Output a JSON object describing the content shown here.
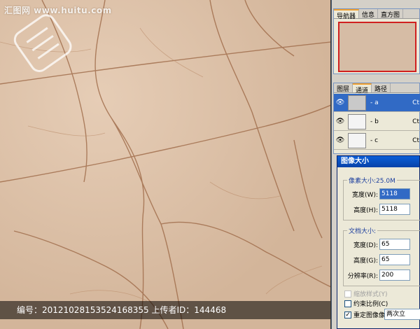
{
  "watermark": {
    "site": "汇图网 www.huitu.com",
    "center_text": "汇图网"
  },
  "caption": "编号：20121028153524168355 上传者ID：144468",
  "navigator": {
    "tabs": [
      "导航器",
      "信息",
      "直方图"
    ]
  },
  "channels": {
    "tabs": [
      "图层",
      "通道",
      "路径"
    ],
    "rows": [
      {
        "label": "- a",
        "shortcut": "Ct"
      },
      {
        "label": "- b",
        "shortcut": "Ct"
      },
      {
        "label": "- c",
        "shortcut": "Ct"
      }
    ]
  },
  "dialog": {
    "title": "图像大小",
    "pixel_group": "像素大小:25.0M",
    "width_label": "宽度(W):",
    "width_value": "5118",
    "height_label": "高度(H):",
    "height_value": "5118",
    "doc_group": "文档大小:",
    "doc_width_label": "宽度(D):",
    "doc_width_value": "65",
    "doc_height_label": "高度(G):",
    "doc_height_value": "65",
    "res_label": "分辨率(R):",
    "res_value": "200",
    "scale_styles": "缩放样式(Y)",
    "constrain": "约束比例(C)",
    "resample": "重定图像像素(I):",
    "resample_method": "两次立"
  }
}
